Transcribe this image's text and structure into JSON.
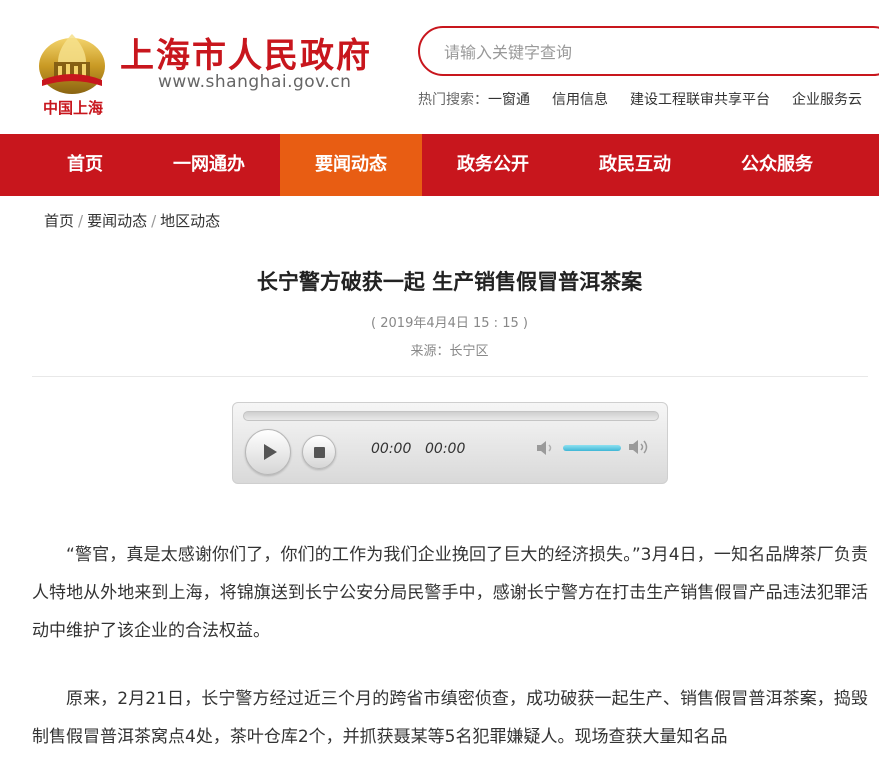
{
  "header": {
    "site_title": "上海市人民政府",
    "site_url": "www.shanghai.gov.cn",
    "logo_caption": "中国上海",
    "search": {
      "placeholder": "请输入关键字查询"
    },
    "hot_search": {
      "label": "热门搜索：",
      "items": [
        "一窗通",
        "信用信息",
        "建设工程联审共享平台",
        "企业服务云"
      ]
    }
  },
  "nav": {
    "items": [
      {
        "label": "首页"
      },
      {
        "label": "一网通办"
      },
      {
        "label": "要闻动态"
      },
      {
        "label": "政务公开"
      },
      {
        "label": "政民互动"
      },
      {
        "label": "公众服务"
      }
    ],
    "active_index": 2
  },
  "breadcrumb": {
    "items": [
      "首页",
      "要闻动态",
      "地区动态"
    ],
    "separator": "/"
  },
  "article": {
    "title": "长宁警方破获一起 生产销售假冒普洱茶案",
    "date": "( 2019年4月4日 15 : 15 )",
    "source": "来源：长宁区",
    "paragraphs": [
      "“警官，真是太感谢你们了，你们的工作为我们企业挽回了巨大的经济损失。”3月4日，一知名品牌茶厂负责人特地从外地来到上海，将锦旗送到长宁公安分局民警手中，感谢长宁警方在打击生产销售假冒产品违法犯罪活动中维护了该企业的合法权益。",
      "原来，2月21日，长宁警方经过近三个月的跨省市缜密侦查，成功破获一起生产、销售假冒普洱茶案，捣毁制售假冒普洱茶窝点4处，茶叶仓库2个，并抓获聂某等5名犯罪嫌疑人。现场查获大量知名品"
    ]
  },
  "player": {
    "current_time": "00:00",
    "duration": "00:00"
  },
  "colors": {
    "brand_red": "#c8161d",
    "nav_active": "#e85d13",
    "volume_fill": "#3fb6d6"
  }
}
